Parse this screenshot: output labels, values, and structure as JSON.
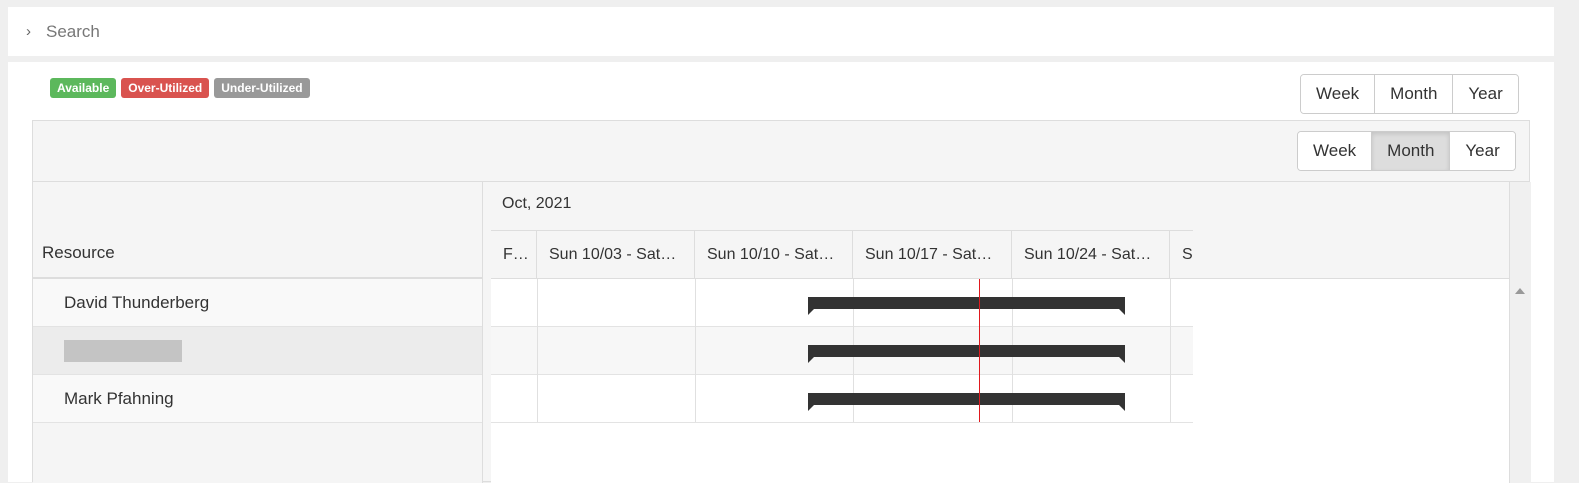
{
  "search": {
    "label": "Search",
    "icon": "chevron-right-icon"
  },
  "legend": [
    {
      "label": "Available",
      "color": "#5cb85c"
    },
    {
      "label": "Over-Utilized",
      "color": "#d9534f"
    },
    {
      "label": "Under-Utilized",
      "color": "#999999"
    }
  ],
  "top_view_buttons": [
    "Week",
    "Month",
    "Year"
  ],
  "scheduler": {
    "view_buttons": [
      "Week",
      "Month",
      "Year"
    ],
    "active_view": "Month",
    "resource_header": "Resource",
    "month_label": "Oct, 2021",
    "weeks": [
      "F…",
      "Sun 10/03 - Sat…",
      "Sun 10/10 - Sat…",
      "Sun 10/17 - Sat…",
      "Sun 10/24 - Sat…",
      "S"
    ],
    "resources": [
      {
        "name": "David Thunderberg",
        "redacted": false
      },
      {
        "name": "",
        "redacted": true
      },
      {
        "name": "Mark Pfahning",
        "redacted": false
      }
    ]
  },
  "colors": {
    "today_line": "#e0191e",
    "bar": "#333333"
  }
}
